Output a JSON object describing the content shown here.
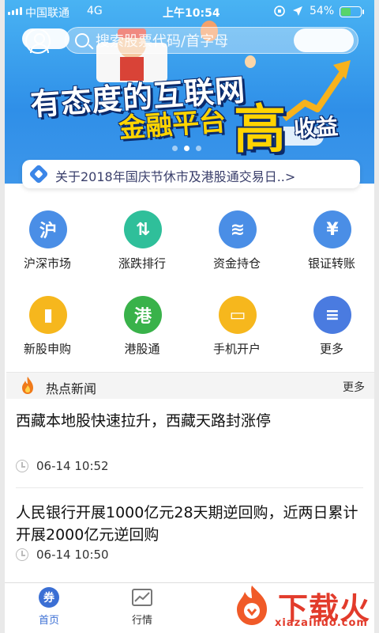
{
  "status_bar": {
    "carrier": "中国联通",
    "network": "4G",
    "time": "上午10:54",
    "battery_percent": "54%",
    "battery_level": 0.54
  },
  "search": {
    "placeholder": "搜索股票代码/首字母"
  },
  "banner": {
    "line1": "有态度的互联网",
    "line2": "金融平台",
    "big_char": "高",
    "line3": "收益",
    "page_count": 3,
    "active_page": 1
  },
  "notice": {
    "text": "关于2018年国庆节休市及港股通交易日..>"
  },
  "grid": {
    "items": [
      {
        "label": "沪深市场",
        "icon": "shanghai-shenzhen-market-icon",
        "color": "#4a8ee6",
        "glyph": "沪"
      },
      {
        "label": "涨跌排行",
        "icon": "up-down-ranking-icon",
        "color": "#2fbf9a",
        "glyph": "⇅"
      },
      {
        "label": "资金持仓",
        "icon": "coins-icon",
        "color": "#4a8ee6",
        "glyph": "≋"
      },
      {
        "label": "银证转账",
        "icon": "bank-transfer-icon",
        "color": "#4a8ee6",
        "glyph": "¥"
      },
      {
        "label": "新股申购",
        "icon": "new-stock-icon",
        "color": "#f6b71d",
        "glyph": "▮"
      },
      {
        "label": "港股通",
        "icon": "hk-connect-icon",
        "color": "#39b24a",
        "glyph": "港"
      },
      {
        "label": "手机开户",
        "icon": "card-open-account-icon",
        "color": "#f6b71d",
        "glyph": "▭"
      },
      {
        "label": "更多",
        "icon": "more-menu-icon",
        "color": "#4a7be0",
        "glyph": "≡"
      }
    ]
  },
  "news": {
    "title": "热点新闻",
    "more": "更多",
    "items": [
      {
        "headline": "西藏本地股快速拉升，西藏天路封涨停",
        "time": "06-14 10:52"
      },
      {
        "headline": "人民银行开展1000亿元28天期逆回购，近两日累计开展2000亿元逆回购",
        "time": "06-14 10:50"
      }
    ]
  },
  "bottom_nav": {
    "tabs": [
      {
        "label": "首页",
        "glyph": "券",
        "active": true
      },
      {
        "label": "行情",
        "active": false
      }
    ]
  },
  "watermark": {
    "brand": "下载火",
    "url": "xiazaihuo.com"
  },
  "colors": {
    "banner_top": "#49b3f3",
    "banner_bottom": "#2f8fe8",
    "accent": "#3b6fd4",
    "watermark": "#e23b2b"
  }
}
